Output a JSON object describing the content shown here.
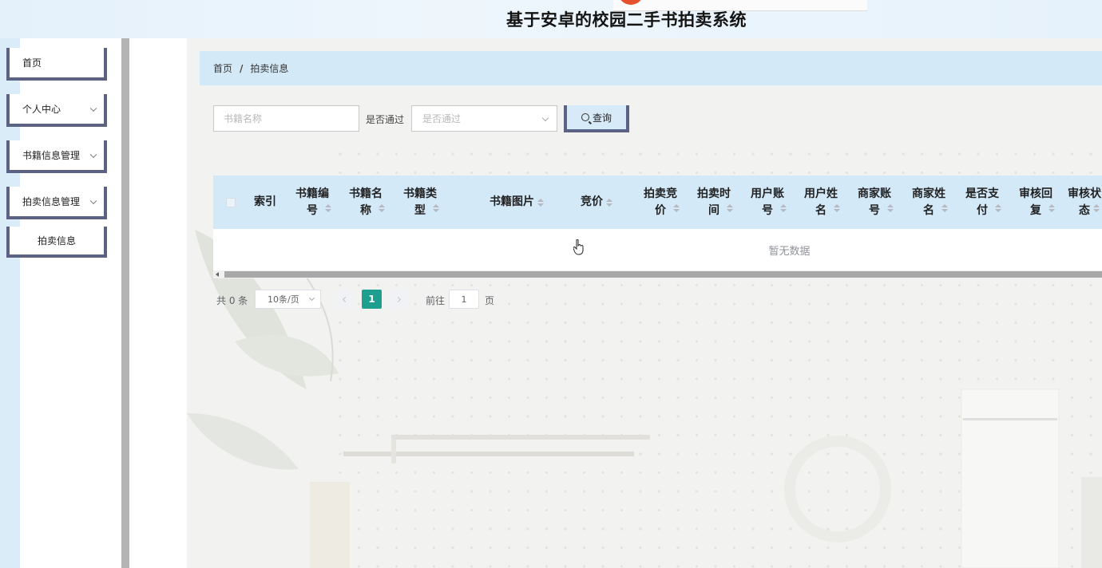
{
  "header": {
    "system_title": "基于安卓的校园二手书拍卖系统"
  },
  "sidebar": {
    "items": [
      {
        "label": "首页",
        "has_submenu": false
      },
      {
        "label": "个人中心",
        "has_submenu": true
      },
      {
        "label": "书籍信息管理",
        "has_submenu": true
      },
      {
        "label": "拍卖信息管理",
        "has_submenu": true
      },
      {
        "label": "拍卖信息",
        "has_submenu": false
      }
    ]
  },
  "breadcrumb": {
    "home": "首页",
    "separator": "/",
    "current": "拍卖信息"
  },
  "search": {
    "name_placeholder": "书籍名称",
    "name_value": "",
    "approved_label": "是否通过",
    "approved_placeholder": "是否通过",
    "query_label": "查询"
  },
  "table": {
    "columns": [
      {
        "label": "索引",
        "sortable": false
      },
      {
        "label": "书籍编号",
        "sortable": true
      },
      {
        "label": "书籍名称",
        "sortable": true
      },
      {
        "label": "书籍类型",
        "sortable": true
      },
      {
        "label": "书籍图片",
        "sortable": true
      },
      {
        "label": "竞价",
        "sortable": true
      },
      {
        "label": "拍卖竞价",
        "sortable": true
      },
      {
        "label": "拍卖时间",
        "sortable": true
      },
      {
        "label": "用户账号",
        "sortable": true
      },
      {
        "label": "用户姓名",
        "sortable": true
      },
      {
        "label": "商家账号",
        "sortable": true
      },
      {
        "label": "商家姓名",
        "sortable": true
      },
      {
        "label": "是否支付",
        "sortable": true
      },
      {
        "label": "审核回复",
        "sortable": true
      },
      {
        "label": "审核状态",
        "sortable": true
      }
    ],
    "rows": [],
    "empty_text": "暂无数据"
  },
  "pagination": {
    "total_text": "共 0 条",
    "page_size": "10条/页",
    "current_page": "1",
    "goto_prefix": "前往",
    "goto_value": "1",
    "goto_suffix": "页"
  },
  "colors": {
    "accent_header": "#d3e9f8",
    "nav_border": "#5b6284",
    "page_active": "#1e9e8e"
  }
}
